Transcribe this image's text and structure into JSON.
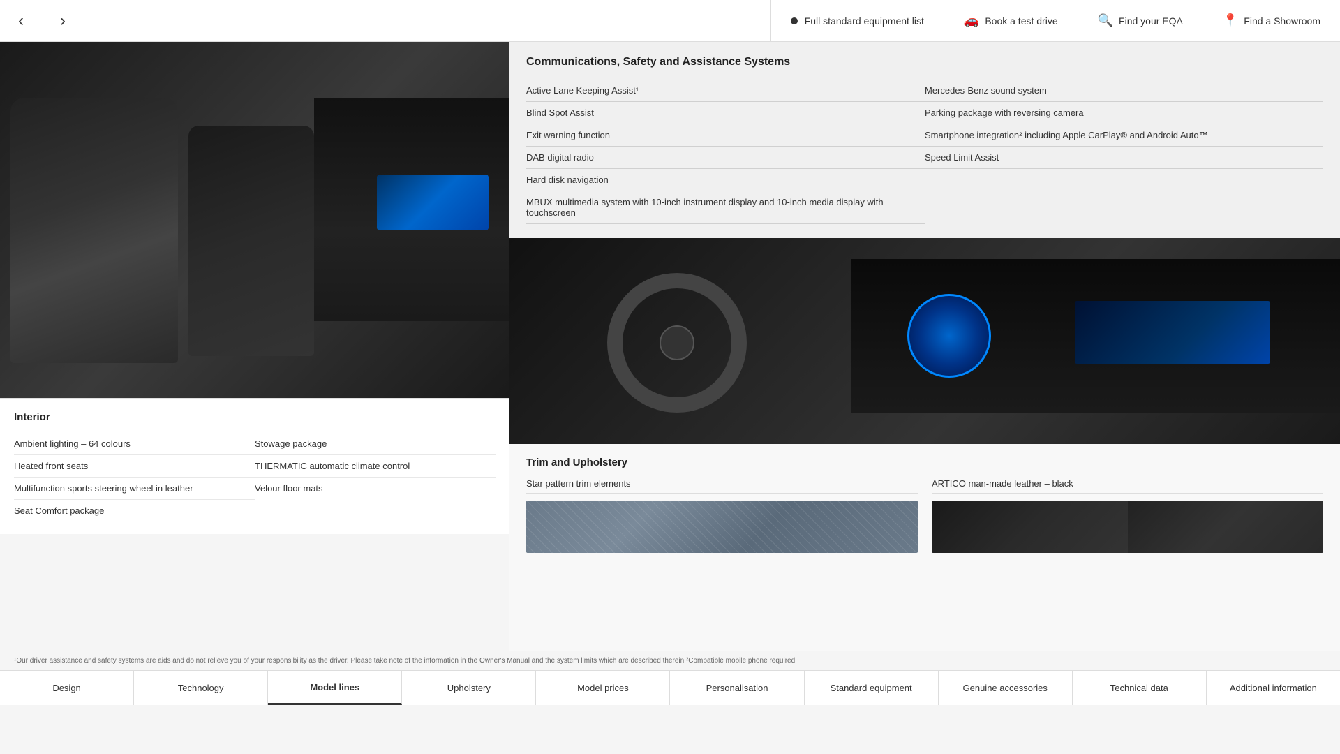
{
  "header": {
    "prev_label": "‹",
    "next_label": "›",
    "equipment_label": "Full standard equipment list",
    "test_drive_label": "Book a test drive",
    "find_eqa_label": "Find your EQA",
    "find_showroom_label": "Find a Showroom"
  },
  "comms": {
    "title": "Communications, Safety and Assistance Systems",
    "left_items": [
      "Active Lane Keeping Assist¹",
      "Blind Spot Assist",
      "Exit warning function",
      "DAB digital radio",
      "Hard disk navigation",
      "MBUX multimedia system with 10-inch instrument display and 10-inch media display with touchscreen"
    ],
    "right_items": [
      "Mercedes-Benz sound system",
      "Parking package with reversing camera",
      "Smartphone integration² including Apple CarPlay® and Android Auto™",
      "Speed Limit Assist"
    ]
  },
  "interior": {
    "title": "Interior",
    "col1": [
      "Ambient lighting – 64 colours",
      "Heated front seats",
      "Multifunction sports steering wheel in leather",
      "Seat Comfort package"
    ],
    "col2": [
      "Stowage package",
      "THERMATIC automatic climate control",
      "Velour floor mats"
    ]
  },
  "trim": {
    "title": "Trim and Upholstery",
    "col1_label": "Star pattern trim elements",
    "col2_label": "ARTICO man-made leather – black"
  },
  "disclaimer": "¹Our driver assistance and safety systems are aids and do not relieve you of your responsibility as the driver. Please take note of the information in the Owner's Manual and the system limits which are described therein    ²Compatible mobile phone required",
  "footer": {
    "items": [
      "Design",
      "Technology",
      "Model lines",
      "Upholstery",
      "Model prices",
      "Personalisation",
      "Standard equipment",
      "Genuine accessories",
      "Technical data",
      "Additional information"
    ],
    "active_index": 2
  }
}
